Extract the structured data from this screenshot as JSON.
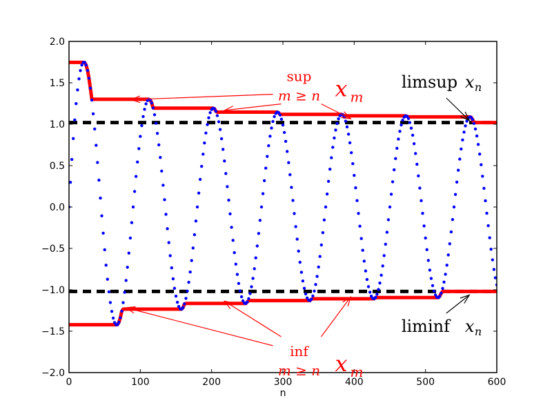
{
  "chart_data": {
    "type": "line",
    "title": "",
    "xlabel": "n",
    "ylabel": "",
    "xlim": [
      0,
      600
    ],
    "ylim": [
      -2.0,
      2.0
    ],
    "x_ticks": [
      0,
      100,
      200,
      300,
      400,
      500,
      600
    ],
    "x_tick_labels": [
      "0",
      "100",
      "200",
      "300",
      "400",
      "500",
      "600"
    ],
    "y_ticks": [
      -2.0,
      -1.5,
      -1.0,
      -0.5,
      0.0,
      0.5,
      1.0,
      1.5,
      2.0
    ],
    "y_tick_labels": [
      "−2.0",
      "−1.5",
      "−1.0",
      "−0.5",
      "0.0",
      "0.5",
      "1.0",
      "1.5",
      "2.0"
    ],
    "grid": false,
    "series": [
      {
        "name": "x_n",
        "style": "dotted-markers",
        "color": "#0000ff",
        "description": "damped oscillation x_n = (L + a/(n+b)) * sin(2*pi*n/period)",
        "formula": {
          "L": 1.02,
          "a": 41.3,
          "b": 34.8,
          "period": 90,
          "n_start": 0,
          "n_end": 600,
          "step": 2
        }
      },
      {
        "name": "sup_{m>=n} x_m",
        "style": "thick-line",
        "color": "#ff0000",
        "description": "running supremum of x_m for m >= n"
      },
      {
        "name": "inf_{m>=n} x_m",
        "style": "thick-line",
        "color": "#ff0000",
        "description": "running infimum of x_m for m >= n"
      },
      {
        "name": "limsup x_n",
        "style": "dashed",
        "color": "#000000",
        "value": 1.02
      },
      {
        "name": "liminf x_n",
        "style": "dashed",
        "color": "#000000",
        "value": -1.02
      }
    ],
    "annotations": [
      {
        "id": "sup",
        "op": "sup",
        "sub": "m ≥ n",
        "var": "x",
        "var_sub": "m",
        "color": "#ff0000",
        "arrow_targets": [
          [
            87,
            1.28
          ],
          [
            218,
            1.15
          ],
          [
            395,
            1.05
          ]
        ],
        "anchor": [
          315,
          1.72
        ]
      },
      {
        "id": "inf",
        "op": "inf",
        "sub": "m ≥ n",
        "var": "x",
        "var_sub": "m",
        "color": "#ff0000",
        "arrow_targets": [
          [
            80,
            -1.2
          ],
          [
            218,
            -1.12
          ],
          [
            395,
            -1.07
          ]
        ],
        "anchor": [
          315,
          -1.55
        ]
      },
      {
        "id": "limsup",
        "op": "limsup",
        "var": "x",
        "var_sub": "n",
        "color": "#000000",
        "arrow_target": [
          545,
          1.02
        ],
        "anchor": [
          505,
          1.5
        ]
      },
      {
        "id": "liminf",
        "op": "liminf",
        "var": "x",
        "var_sub": "n",
        "color": "#000000",
        "arrow_target": [
          545,
          -1.03
        ],
        "anchor": [
          505,
          -1.45
        ]
      }
    ]
  }
}
